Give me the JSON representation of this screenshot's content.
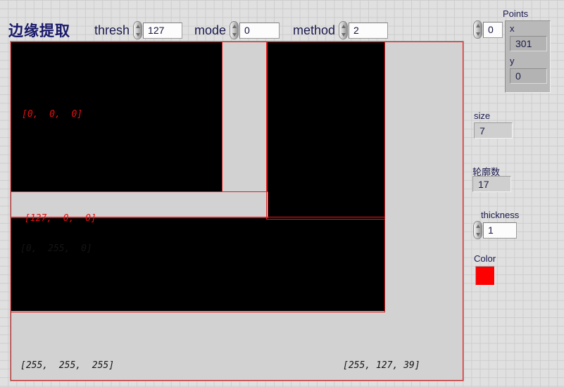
{
  "window": {
    "title": "边缘提取"
  },
  "header": {
    "thresh": {
      "label": "thresh",
      "value": "127"
    },
    "mode": {
      "label": "mode",
      "value": "0"
    },
    "method": {
      "label": "method",
      "value": "2"
    }
  },
  "image": {
    "annotations": [
      {
        "text": "[0,  0,  0]",
        "color": "red"
      },
      {
        "text": "[127,  0,  0]",
        "color": "red"
      },
      {
        "text": "[0,  255,  0]",
        "color": "dark"
      },
      {
        "text": "[255,  255,  255]",
        "color": "dark"
      },
      {
        "text": "[255, 127, 39]",
        "color": "dark"
      }
    ],
    "outline_color": "#e02020",
    "background_color": "#000000",
    "fill_color": "#d2d2d2"
  },
  "panel": {
    "points": {
      "label": "Points",
      "index": "0",
      "x_label": "x",
      "x_value": "301",
      "y_label": "y",
      "y_value": "0"
    },
    "size": {
      "label": "size",
      "value": "7"
    },
    "contours": {
      "label": "轮廓数",
      "value": "17"
    },
    "thickness": {
      "label": "thickness",
      "value": "1"
    },
    "color": {
      "label": "Color",
      "value": "#ff0000"
    }
  }
}
